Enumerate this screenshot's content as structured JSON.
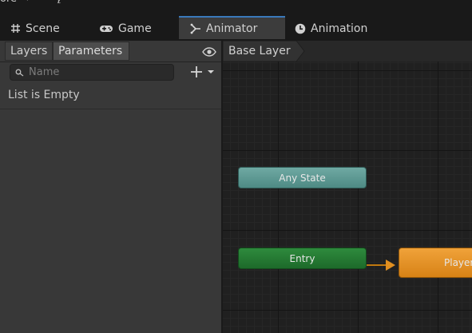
{
  "topbar": {
    "truncated_label": "ore"
  },
  "tabs": [
    {
      "label": "Scene",
      "icon": "grid-icon"
    },
    {
      "label": "Game",
      "icon": "gamepad-icon"
    },
    {
      "label": "Animator",
      "icon": "animator-branch-icon",
      "active": true
    },
    {
      "label": "Animation",
      "icon": "clock-icon"
    }
  ],
  "left_panel": {
    "subtabs": [
      "Layers",
      "Parameters"
    ],
    "active_subtab": "Parameters",
    "search_placeholder": "Name",
    "search_value": "",
    "list_empty_label": "List is Empty"
  },
  "graph": {
    "breadcrumb": "Base Layer",
    "nodes": {
      "any_state": "Any State",
      "entry": "Entry",
      "player": "Player"
    }
  },
  "colors": {
    "accent_tab": "#3a79bb",
    "any_state": "#5e9a94",
    "entry": "#25793a",
    "default_state": "#e69226",
    "transition": "#c0780f"
  }
}
